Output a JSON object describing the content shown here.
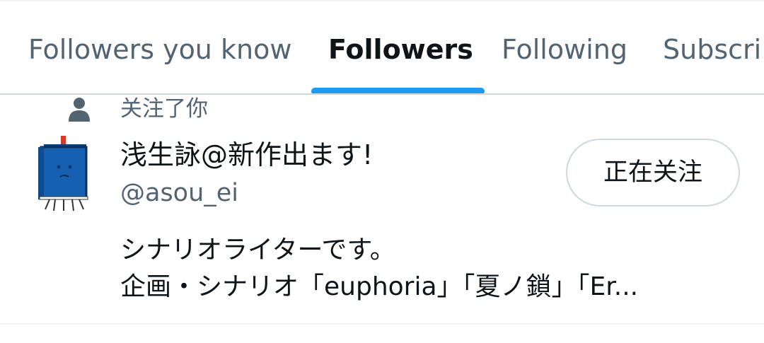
{
  "tabs": [
    {
      "label": "Followers you know",
      "active": false
    },
    {
      "label": "Followers",
      "active": true
    },
    {
      "label": "Following",
      "active": false
    },
    {
      "label": "Subscri",
      "active": false
    }
  ],
  "colors": {
    "accent": "#1d9bf0",
    "text_primary": "#0f1419",
    "text_secondary": "#536471",
    "border": "#cfd9de",
    "avatar_blue": "#1560b0"
  },
  "user": {
    "social_context": "关注了你",
    "social_icon": "person-icon",
    "name": "浅生詠@新作出ます!",
    "handle": "@asou_ei",
    "follow_button_label": "正在关注",
    "bio_lines": [
      "シナリオライターです。",
      "企画・シナリオ「euphoria」「夏ノ鎖」「Er..."
    ]
  }
}
